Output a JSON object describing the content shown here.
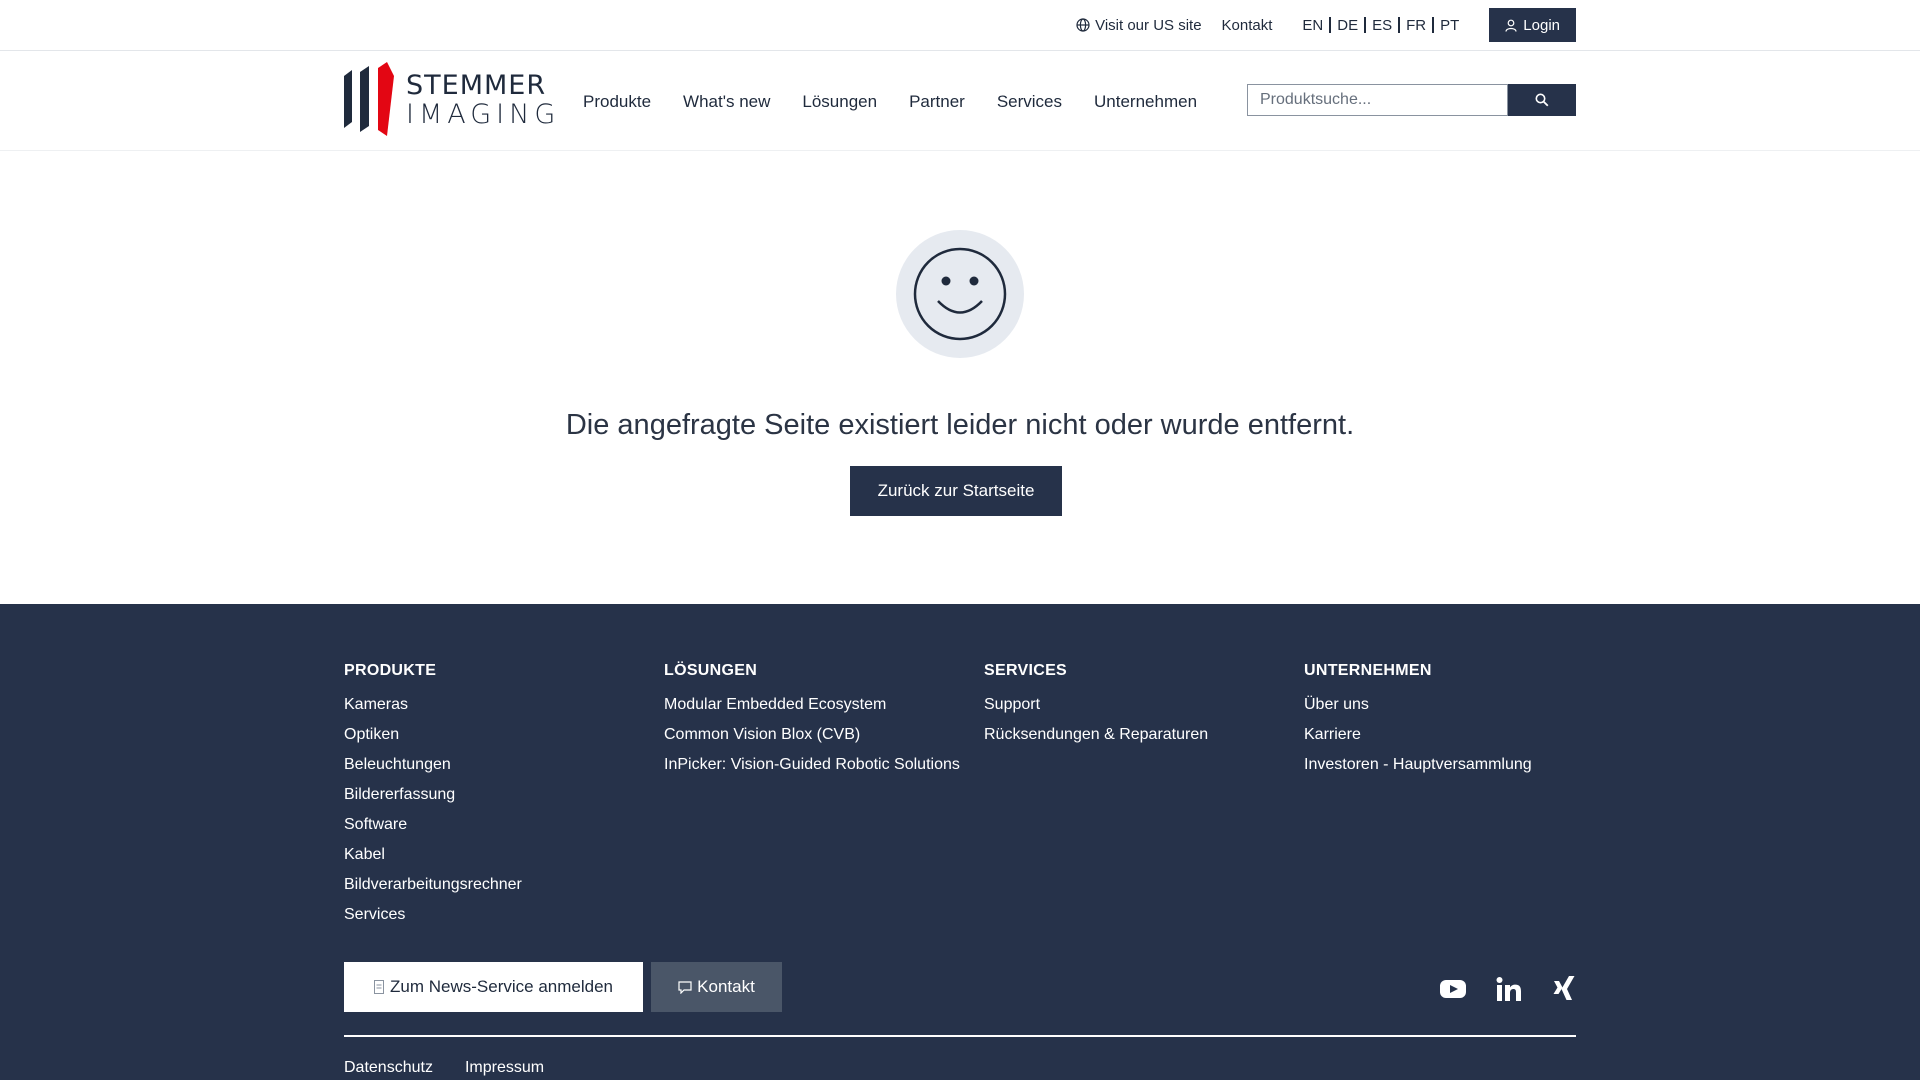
{
  "topbar": {
    "us_site": "Visit our US site",
    "contact": "Kontakt",
    "languages": [
      "EN",
      "DE",
      "ES",
      "FR",
      "PT"
    ],
    "login": "Login"
  },
  "header": {
    "logo_line1": "STEMMER",
    "logo_line2": "IMAGING",
    "nav": [
      "Produkte",
      "What's new",
      "Lösungen",
      "Partner",
      "Services",
      "Unternehmen"
    ],
    "search_placeholder": "Produktsuche..."
  },
  "main": {
    "message": "Die angefragte Seite existiert leider nicht oder wurde entfernt.",
    "back_button": "Zurück zur Startseite"
  },
  "footer": {
    "columns": [
      {
        "title": "PRODUKTE",
        "items": [
          "Kameras",
          "Optiken",
          "Beleuchtungen",
          "Bildererfassung",
          "Software",
          "Kabel",
          "Bildverarbeitungsrechner",
          "Services"
        ]
      },
      {
        "title": "LÖSUNGEN",
        "items": [
          "Modular Embedded Ecosystem",
          "Common Vision Blox (CVB)",
          "InPicker: Vision-Guided Robotic Solutions"
        ]
      },
      {
        "title": "SERVICES",
        "items": [
          "Support",
          "Rücksendungen & Reparaturen"
        ]
      },
      {
        "title": "UNTERNEHMEN",
        "items": [
          "Über uns",
          "Karriere",
          "Investoren - Hauptversammlung"
        ]
      }
    ],
    "news_button": "Zum News-Service anmelden",
    "contact_button": "Kontakt",
    "social": [
      "youtube-icon",
      "linkedin-icon",
      "xing-icon"
    ],
    "legal": [
      "Datenschutz",
      "Impressum"
    ]
  },
  "colors": {
    "navy": "#26324a",
    "logo_red": "#e30613",
    "smiley_bg": "#e6eaf0"
  }
}
